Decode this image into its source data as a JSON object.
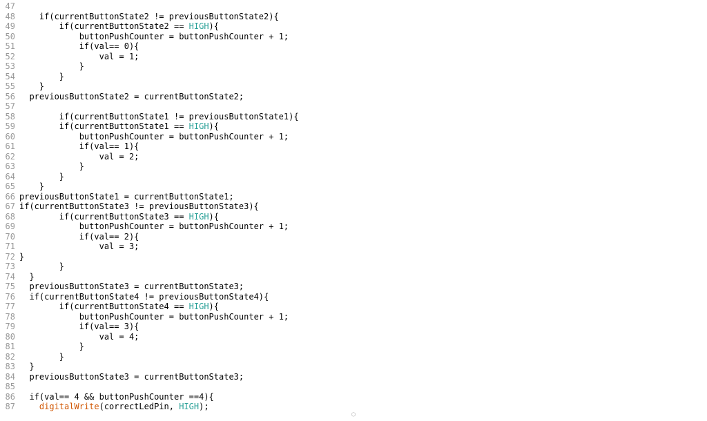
{
  "editor": {
    "first_line_number": 47,
    "lines": [
      {
        "indent": 0,
        "spans": []
      },
      {
        "indent": 2,
        "spans": [
          {
            "t": "if",
            "c": ""
          },
          {
            "t": "(currentButtonState2 != previousButtonState2){",
            "c": ""
          }
        ]
      },
      {
        "indent": 4,
        "spans": [
          {
            "t": "if",
            "c": ""
          },
          {
            "t": "(currentButtonState2 == ",
            "c": ""
          },
          {
            "t": "HIGH",
            "c": "kw"
          },
          {
            "t": "){",
            "c": ""
          }
        ]
      },
      {
        "indent": 6,
        "spans": [
          {
            "t": "buttonPushCounter = buttonPushCounter + 1;",
            "c": ""
          }
        ]
      },
      {
        "indent": 6,
        "spans": [
          {
            "t": "if",
            "c": ""
          },
          {
            "t": "(val== 0){",
            "c": ""
          }
        ]
      },
      {
        "indent": 8,
        "spans": [
          {
            "t": "val = 1;",
            "c": ""
          }
        ]
      },
      {
        "indent": 6,
        "spans": [
          {
            "t": "}",
            "c": ""
          }
        ]
      },
      {
        "indent": 4,
        "spans": [
          {
            "t": "}",
            "c": ""
          }
        ]
      },
      {
        "indent": 2,
        "spans": [
          {
            "t": "}",
            "c": ""
          }
        ]
      },
      {
        "indent": 1,
        "spans": [
          {
            "t": "previousButtonState2 = currentButtonState2;",
            "c": ""
          }
        ]
      },
      {
        "indent": 0,
        "spans": []
      },
      {
        "indent": 4,
        "spans": [
          {
            "t": "if",
            "c": ""
          },
          {
            "t": "(currentButtonState1 != previousButtonState1){",
            "c": ""
          }
        ]
      },
      {
        "indent": 4,
        "spans": [
          {
            "t": "if",
            "c": ""
          },
          {
            "t": "(currentButtonState1 == ",
            "c": ""
          },
          {
            "t": "HIGH",
            "c": "kw"
          },
          {
            "t": "){",
            "c": ""
          }
        ]
      },
      {
        "indent": 6,
        "spans": [
          {
            "t": "buttonPushCounter = buttonPushCounter + 1;",
            "c": ""
          }
        ]
      },
      {
        "indent": 6,
        "spans": [
          {
            "t": "if",
            "c": ""
          },
          {
            "t": "(val== 1){",
            "c": ""
          }
        ]
      },
      {
        "indent": 8,
        "spans": [
          {
            "t": "val = 2;",
            "c": ""
          }
        ]
      },
      {
        "indent": 6,
        "spans": [
          {
            "t": "}",
            "c": ""
          }
        ]
      },
      {
        "indent": 4,
        "spans": [
          {
            "t": "}",
            "c": ""
          }
        ]
      },
      {
        "indent": 2,
        "spans": [
          {
            "t": "}",
            "c": ""
          }
        ]
      },
      {
        "indent": 0,
        "spans": [
          {
            "t": "previousButtonState1 = currentButtonState1;",
            "c": ""
          }
        ]
      },
      {
        "indent": 0,
        "spans": [
          {
            "t": "if",
            "c": ""
          },
          {
            "t": "(currentButtonState3 != previousButtonState3){",
            "c": ""
          }
        ]
      },
      {
        "indent": 4,
        "spans": [
          {
            "t": "if",
            "c": ""
          },
          {
            "t": "(currentButtonState3 == ",
            "c": ""
          },
          {
            "t": "HIGH",
            "c": "kw"
          },
          {
            "t": "){",
            "c": ""
          }
        ]
      },
      {
        "indent": 6,
        "spans": [
          {
            "t": "buttonPushCounter = buttonPushCounter + 1;",
            "c": ""
          }
        ]
      },
      {
        "indent": 6,
        "spans": [
          {
            "t": "if",
            "c": ""
          },
          {
            "t": "(val== 2){",
            "c": ""
          }
        ]
      },
      {
        "indent": 8,
        "spans": [
          {
            "t": "val = 3;",
            "c": ""
          }
        ]
      },
      {
        "indent": 0,
        "spans": [
          {
            "t": "}",
            "c": ""
          }
        ]
      },
      {
        "indent": 4,
        "spans": [
          {
            "t": "}",
            "c": ""
          }
        ]
      },
      {
        "indent": 1,
        "spans": [
          {
            "t": "}",
            "c": ""
          }
        ]
      },
      {
        "indent": 1,
        "spans": [
          {
            "t": "previousButtonState3 = currentButtonState3;",
            "c": ""
          }
        ]
      },
      {
        "indent": 1,
        "spans": [
          {
            "t": "if",
            "c": ""
          },
          {
            "t": "(currentButtonState4 != previousButtonState4){",
            "c": ""
          }
        ]
      },
      {
        "indent": 4,
        "spans": [
          {
            "t": "if",
            "c": ""
          },
          {
            "t": "(currentButtonState4 == ",
            "c": ""
          },
          {
            "t": "HIGH",
            "c": "kw"
          },
          {
            "t": "){",
            "c": ""
          }
        ]
      },
      {
        "indent": 6,
        "spans": [
          {
            "t": "buttonPushCounter = buttonPushCounter + 1;",
            "c": ""
          }
        ]
      },
      {
        "indent": 6,
        "spans": [
          {
            "t": "if",
            "c": ""
          },
          {
            "t": "(val== 3){",
            "c": ""
          }
        ]
      },
      {
        "indent": 8,
        "spans": [
          {
            "t": "val = 4;",
            "c": ""
          }
        ]
      },
      {
        "indent": 6,
        "spans": [
          {
            "t": "}",
            "c": ""
          }
        ]
      },
      {
        "indent": 4,
        "spans": [
          {
            "t": "}",
            "c": ""
          }
        ]
      },
      {
        "indent": 1,
        "spans": [
          {
            "t": "}",
            "c": ""
          }
        ]
      },
      {
        "indent": 1,
        "spans": [
          {
            "t": "previousButtonState3 = currentButtonState3;",
            "c": ""
          }
        ]
      },
      {
        "indent": 0,
        "spans": []
      },
      {
        "indent": 1,
        "spans": [
          {
            "t": "if",
            "c": ""
          },
          {
            "t": "(val== 4 && buttonPushCounter ==4){",
            "c": ""
          }
        ]
      },
      {
        "indent": 2,
        "spans": [
          {
            "t": "digitalWrite",
            "c": "fn"
          },
          {
            "t": "(correctLedPin, ",
            "c": ""
          },
          {
            "t": "HIGH",
            "c": "kw"
          },
          {
            "t": ");",
            "c": ""
          }
        ]
      }
    ]
  },
  "colors": {
    "keyword": "#2aa198",
    "function": "#d05500",
    "gutter": "#999999",
    "text": "#000000",
    "background": "#ffffff"
  }
}
